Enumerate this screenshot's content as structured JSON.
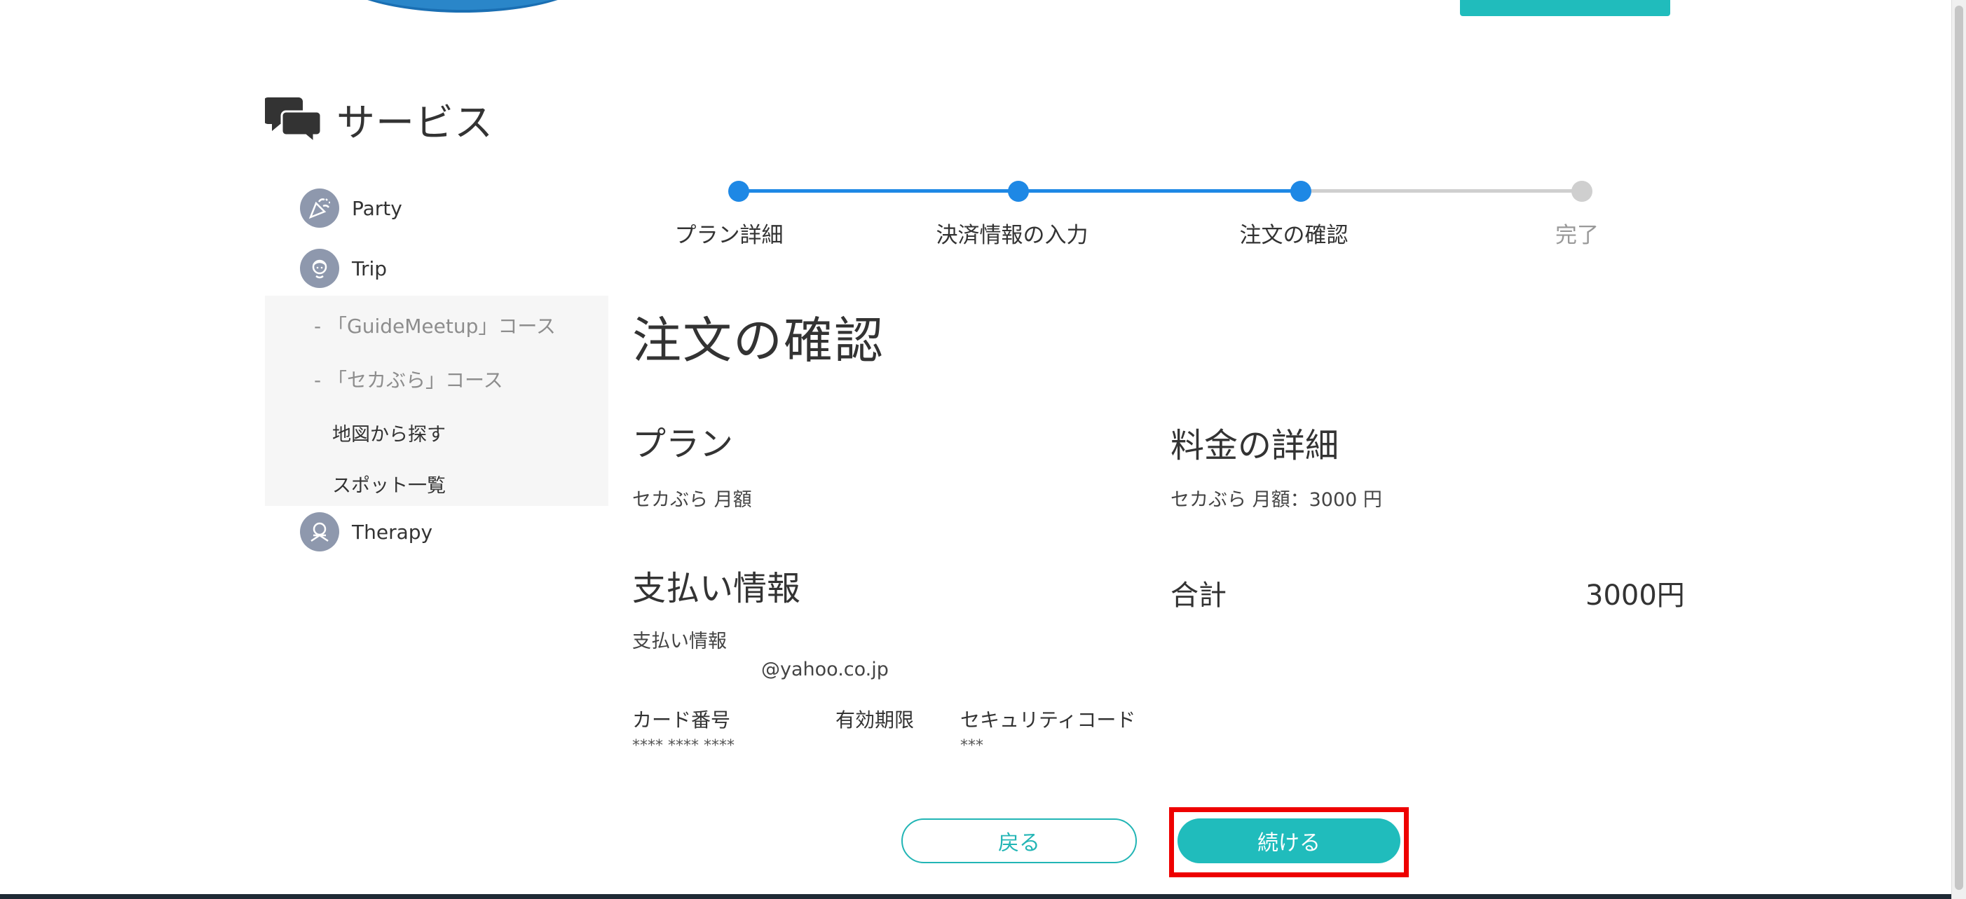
{
  "sidebar": {
    "title": "サービス",
    "items": [
      {
        "label": "Party",
        "icon": "party-popper-icon"
      },
      {
        "label": "Trip",
        "icon": "guide-person-icon"
      },
      {
        "label": "Therapy",
        "icon": "therapy-icon"
      }
    ],
    "sub_items": [
      "- 「GuideMeetup」コース",
      "- 「セカぶら」コース",
      "地図から探す",
      "スポット一覧"
    ]
  },
  "stepper": {
    "steps": [
      "プラン詳細",
      "決済情報の入力",
      "注文の確認",
      "完了"
    ],
    "current_step": 3,
    "active_color": "#1e88e5",
    "inactive_color": "#cfcfcf"
  },
  "main": {
    "title": "注文の確認",
    "plan_heading": "プラン",
    "plan_value": "セカぶら 月額",
    "fee_heading": "料金の詳細",
    "fee_detail": "セカぶら 月額：3000 円",
    "payment_heading": "支払い情報",
    "payment_label": "支払い情報",
    "email": "@yahoo.co.jp",
    "card_number_label": "カード番号",
    "card_number_value": "**** **** ****",
    "expiry_label": "有効期限",
    "security_code_label": "セキュリティコード",
    "security_code_value": "***",
    "total_label": "合計",
    "total_value": "3000円"
  },
  "buttons": {
    "back": "戻る",
    "continue": "続ける"
  },
  "colors": {
    "accent": "#20bcbc",
    "highlight": "#ee0000"
  }
}
